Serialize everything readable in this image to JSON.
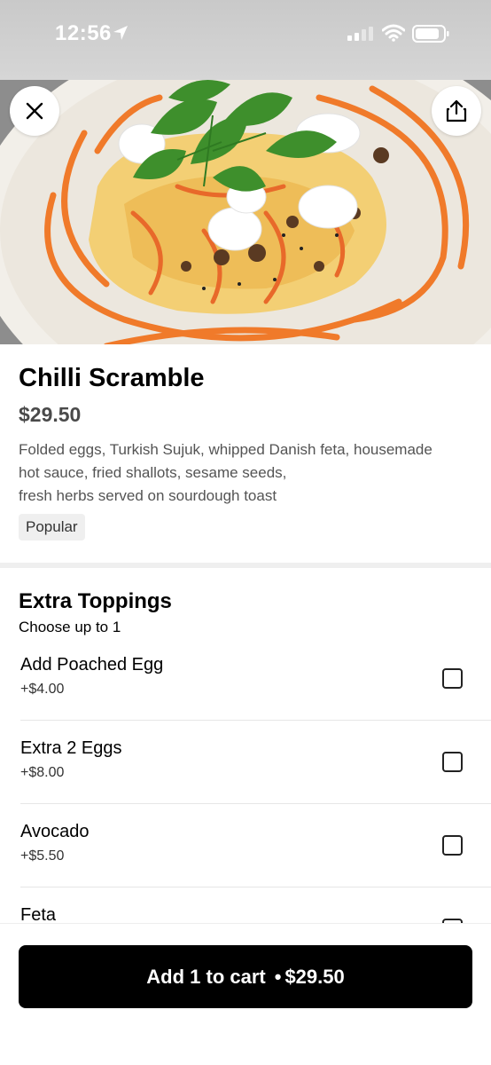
{
  "status_bar": {
    "time": "12:56"
  },
  "icons": {
    "close": "close-icon",
    "share": "share-icon",
    "location": "location-arrow-icon",
    "signal": "signal-icon",
    "wifi": "wifi-icon",
    "battery": "battery-icon"
  },
  "item": {
    "title": "Chilli Scramble",
    "price": "$29.50",
    "description": "Folded eggs, Turkish Sujuk, whipped Danish feta, housemade\nhot sauce, fried shallots, sesame seeds,\nfresh herbs served on sourdough toast",
    "badge": "Popular"
  },
  "section": {
    "title": "Extra Toppings",
    "subtitle": "Choose up to 1",
    "options": [
      {
        "name": "Add Poached Egg",
        "price": "+$4.00"
      },
      {
        "name": "Extra 2 Eggs",
        "price": "+$8.00"
      },
      {
        "name": "Avocado",
        "price": "+$5.50"
      },
      {
        "name": "Feta",
        "price": ""
      }
    ]
  },
  "cart": {
    "label": "Add 1 to cart",
    "separator": "•",
    "price": "$29.50"
  },
  "colors": {
    "button_bg": "#000000",
    "badge_bg": "#efefef",
    "sauce": "#f07a2a"
  }
}
